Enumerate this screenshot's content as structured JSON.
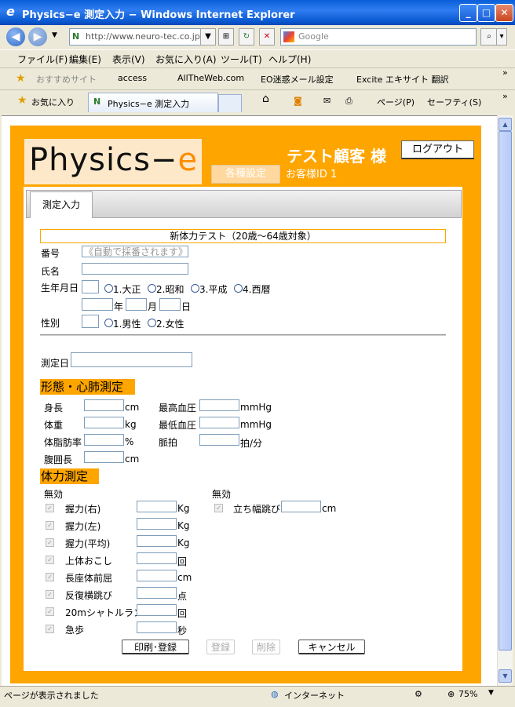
{
  "window": {
    "title": "Physics−e 測定入力 − Windows Internet Explorer"
  },
  "toolbar": {
    "address": "http://www.neuro-tec.co.jp/",
    "search_placeholder": "Google"
  },
  "menu": [
    "ファイル(F)",
    "編集(E)",
    "表示(V)",
    "お気に入り(A)",
    "ツール(T)",
    "ヘルプ(H)"
  ],
  "links": [
    "おすすめサイト",
    "access",
    "AllTheWeb.com",
    "EO迷惑メール設定",
    "Excite エキサイト 翻訳"
  ],
  "tabs": {
    "favorites": "お気に入り",
    "current": "Physics−e 測定入力"
  },
  "commands": {
    "page": "ページ(P)",
    "safety": "セーフティ(S)"
  },
  "header": {
    "logo_main": "Physics−",
    "logo_accent": "e",
    "settings_button": "各種設定",
    "customer_name": "テスト顧客 様",
    "customer_id": "お客様ID 1",
    "logout_button": "ログアウト"
  },
  "form": {
    "tab": "測定入力",
    "test_title": "新体力テスト（20歳〜64歳対象）",
    "number_label": "番号",
    "number_placeholder": "《自動で採番されます》",
    "name_label": "氏名",
    "birth_label": "生年月日",
    "eras": [
      "1.大正",
      "2.昭和",
      "3.平成",
      "4.西暦"
    ],
    "year_unit": "年",
    "month_unit": "月",
    "day_unit": "日",
    "sex_label": "性別",
    "sexes": [
      "1.男性",
      "2.女性"
    ],
    "date_label": "測定日",
    "section1": "形態・心肺測定",
    "body_left": [
      {
        "label": "身長",
        "unit": "cm"
      },
      {
        "label": "体重",
        "unit": "kg"
      },
      {
        "label": "体脂肪率",
        "unit": "%"
      },
      {
        "label": "腹囲長",
        "unit": "cm"
      }
    ],
    "body_right": [
      {
        "label": "最高血圧",
        "unit": "mmHg"
      },
      {
        "label": "最低血圧",
        "unit": "mmHg"
      },
      {
        "label": "脈拍",
        "unit": "拍/分"
      }
    ],
    "section2": "体力測定",
    "invalid_label": "無効",
    "fitness_left": [
      {
        "label": "握力(右)",
        "unit": "Kg"
      },
      {
        "label": "握力(左)",
        "unit": "Kg"
      },
      {
        "label": "握力(平均)",
        "unit": "Kg"
      },
      {
        "label": "上体おこし",
        "unit": "回"
      },
      {
        "label": "長座体前屈",
        "unit": "cm"
      },
      {
        "label": "反復横跳び",
        "unit": "点"
      },
      {
        "label": "20mシャトルラン",
        "unit": "回"
      },
      {
        "label": "急歩",
        "unit": "秒"
      }
    ],
    "fitness_right": [
      {
        "label": "立ち幅跳び",
        "unit": "cm"
      }
    ],
    "buttons": {
      "print_register": "印刷･登録",
      "register": "登録",
      "delete": "削除",
      "cancel": "キャンセル"
    }
  },
  "status": {
    "text": "ページが表示されました",
    "zone": "インターネット",
    "zoom": "75%"
  }
}
